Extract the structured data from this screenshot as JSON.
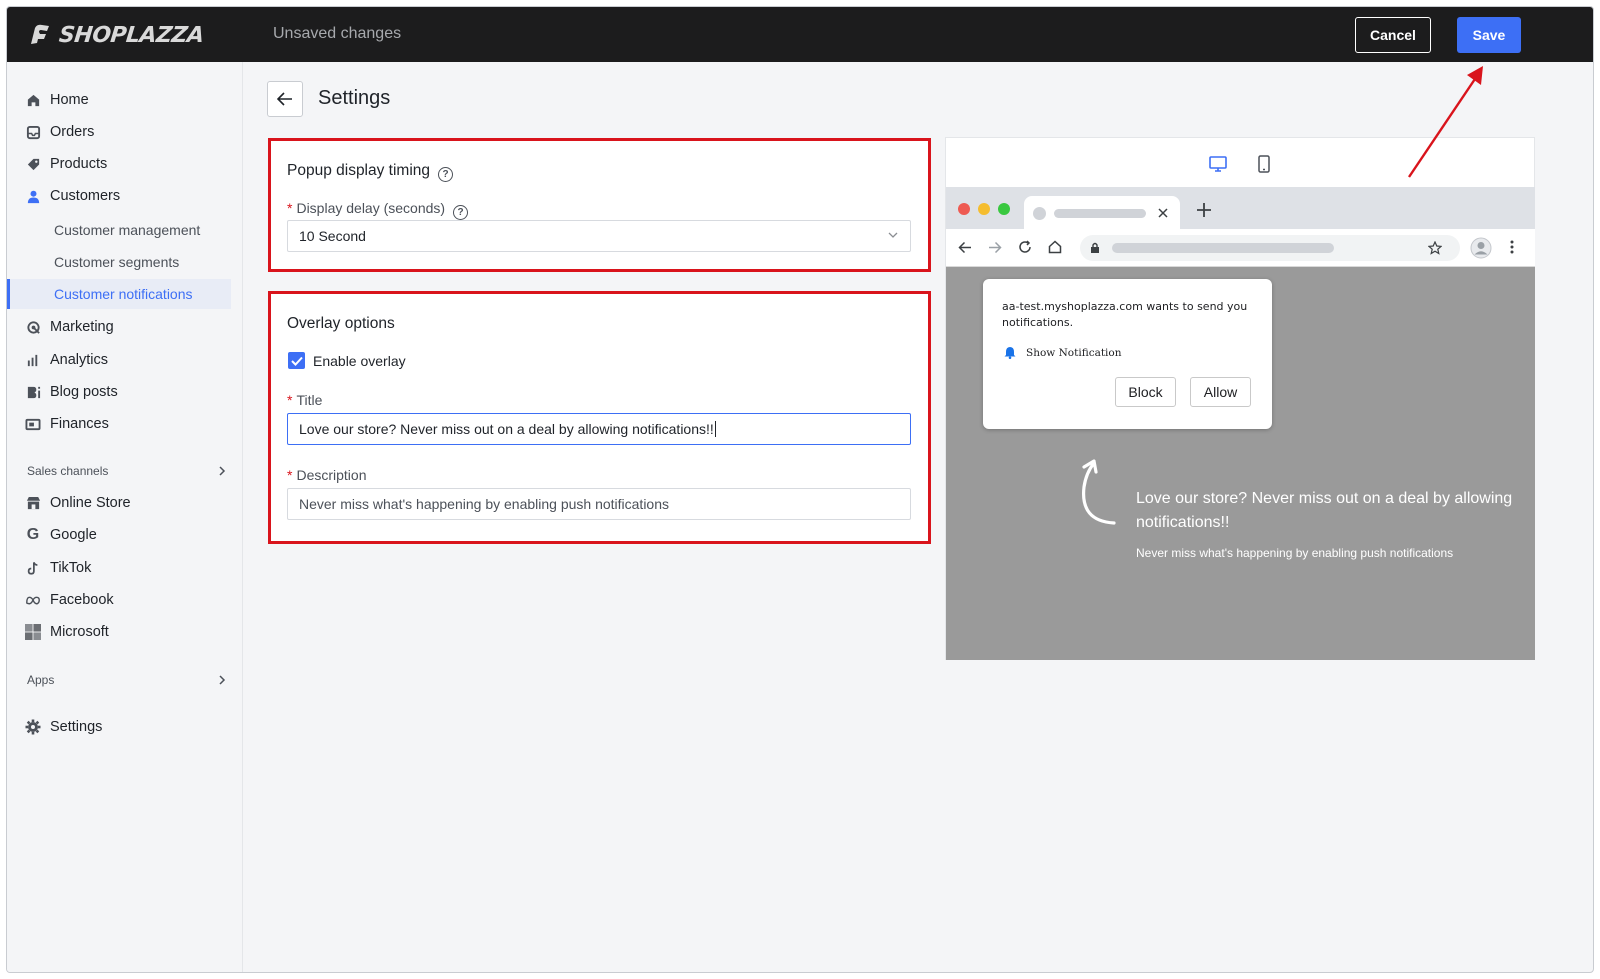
{
  "brand": {
    "name": "SHOPLAZZA"
  },
  "topbar": {
    "status": "Unsaved changes",
    "cancel_label": "Cancel",
    "save_label": "Save"
  },
  "sidebar": {
    "items": [
      {
        "label": "Home",
        "icon": "home-icon"
      },
      {
        "label": "Orders",
        "icon": "inbox-icon"
      },
      {
        "label": "Products",
        "icon": "tag-icon"
      },
      {
        "label": "Customers",
        "icon": "user-icon"
      }
    ],
    "customer_sub": [
      "Customer management",
      "Customer segments",
      "Customer notifications"
    ],
    "items2": [
      {
        "label": "Marketing",
        "icon": "marketing-icon"
      },
      {
        "label": "Analytics",
        "icon": "bar-chart-icon"
      },
      {
        "label": "Blog posts",
        "icon": "blog-icon"
      },
      {
        "label": "Finances",
        "icon": "finance-icon"
      }
    ],
    "sales_channels_label": "Sales channels",
    "channels": [
      {
        "label": "Online Store",
        "icon": "store-icon"
      },
      {
        "label": "Google",
        "icon": "google-icon"
      },
      {
        "label": "TikTok",
        "icon": "tiktok-icon"
      },
      {
        "label": "Facebook",
        "icon": "meta-icon"
      },
      {
        "label": "Microsoft",
        "icon": "microsoft-icon"
      }
    ],
    "apps_label": "Apps",
    "settings_label": "Settings"
  },
  "page": {
    "title": "Settings"
  },
  "popup_timing": {
    "title": "Popup display timing",
    "delay_label": "Display delay (seconds)",
    "delay_value": "10 Second"
  },
  "overlay": {
    "title": "Overlay options",
    "enable_label": "Enable overlay",
    "enable_checked": true,
    "title_label": "Title",
    "title_value": "Love our store? Never miss out on a deal by allowing notifications!!",
    "description_label": "Description",
    "description_value": "Never miss what's happening by enabling push notifications"
  },
  "preview": {
    "notification_text": "aa-test.myshoplazza.com wants to send you notifications.",
    "show_notification": "Show Notification",
    "block_label": "Block",
    "allow_label": "Allow",
    "overlay_title": "Love our store? Never miss out on a deal by allowing notifications!!",
    "overlay_description": "Never miss what's happening by enabling push notifications"
  },
  "colors": {
    "accent": "#3d6ff5",
    "highlight": "#d9141c",
    "topbar": "#1c1c1d"
  }
}
